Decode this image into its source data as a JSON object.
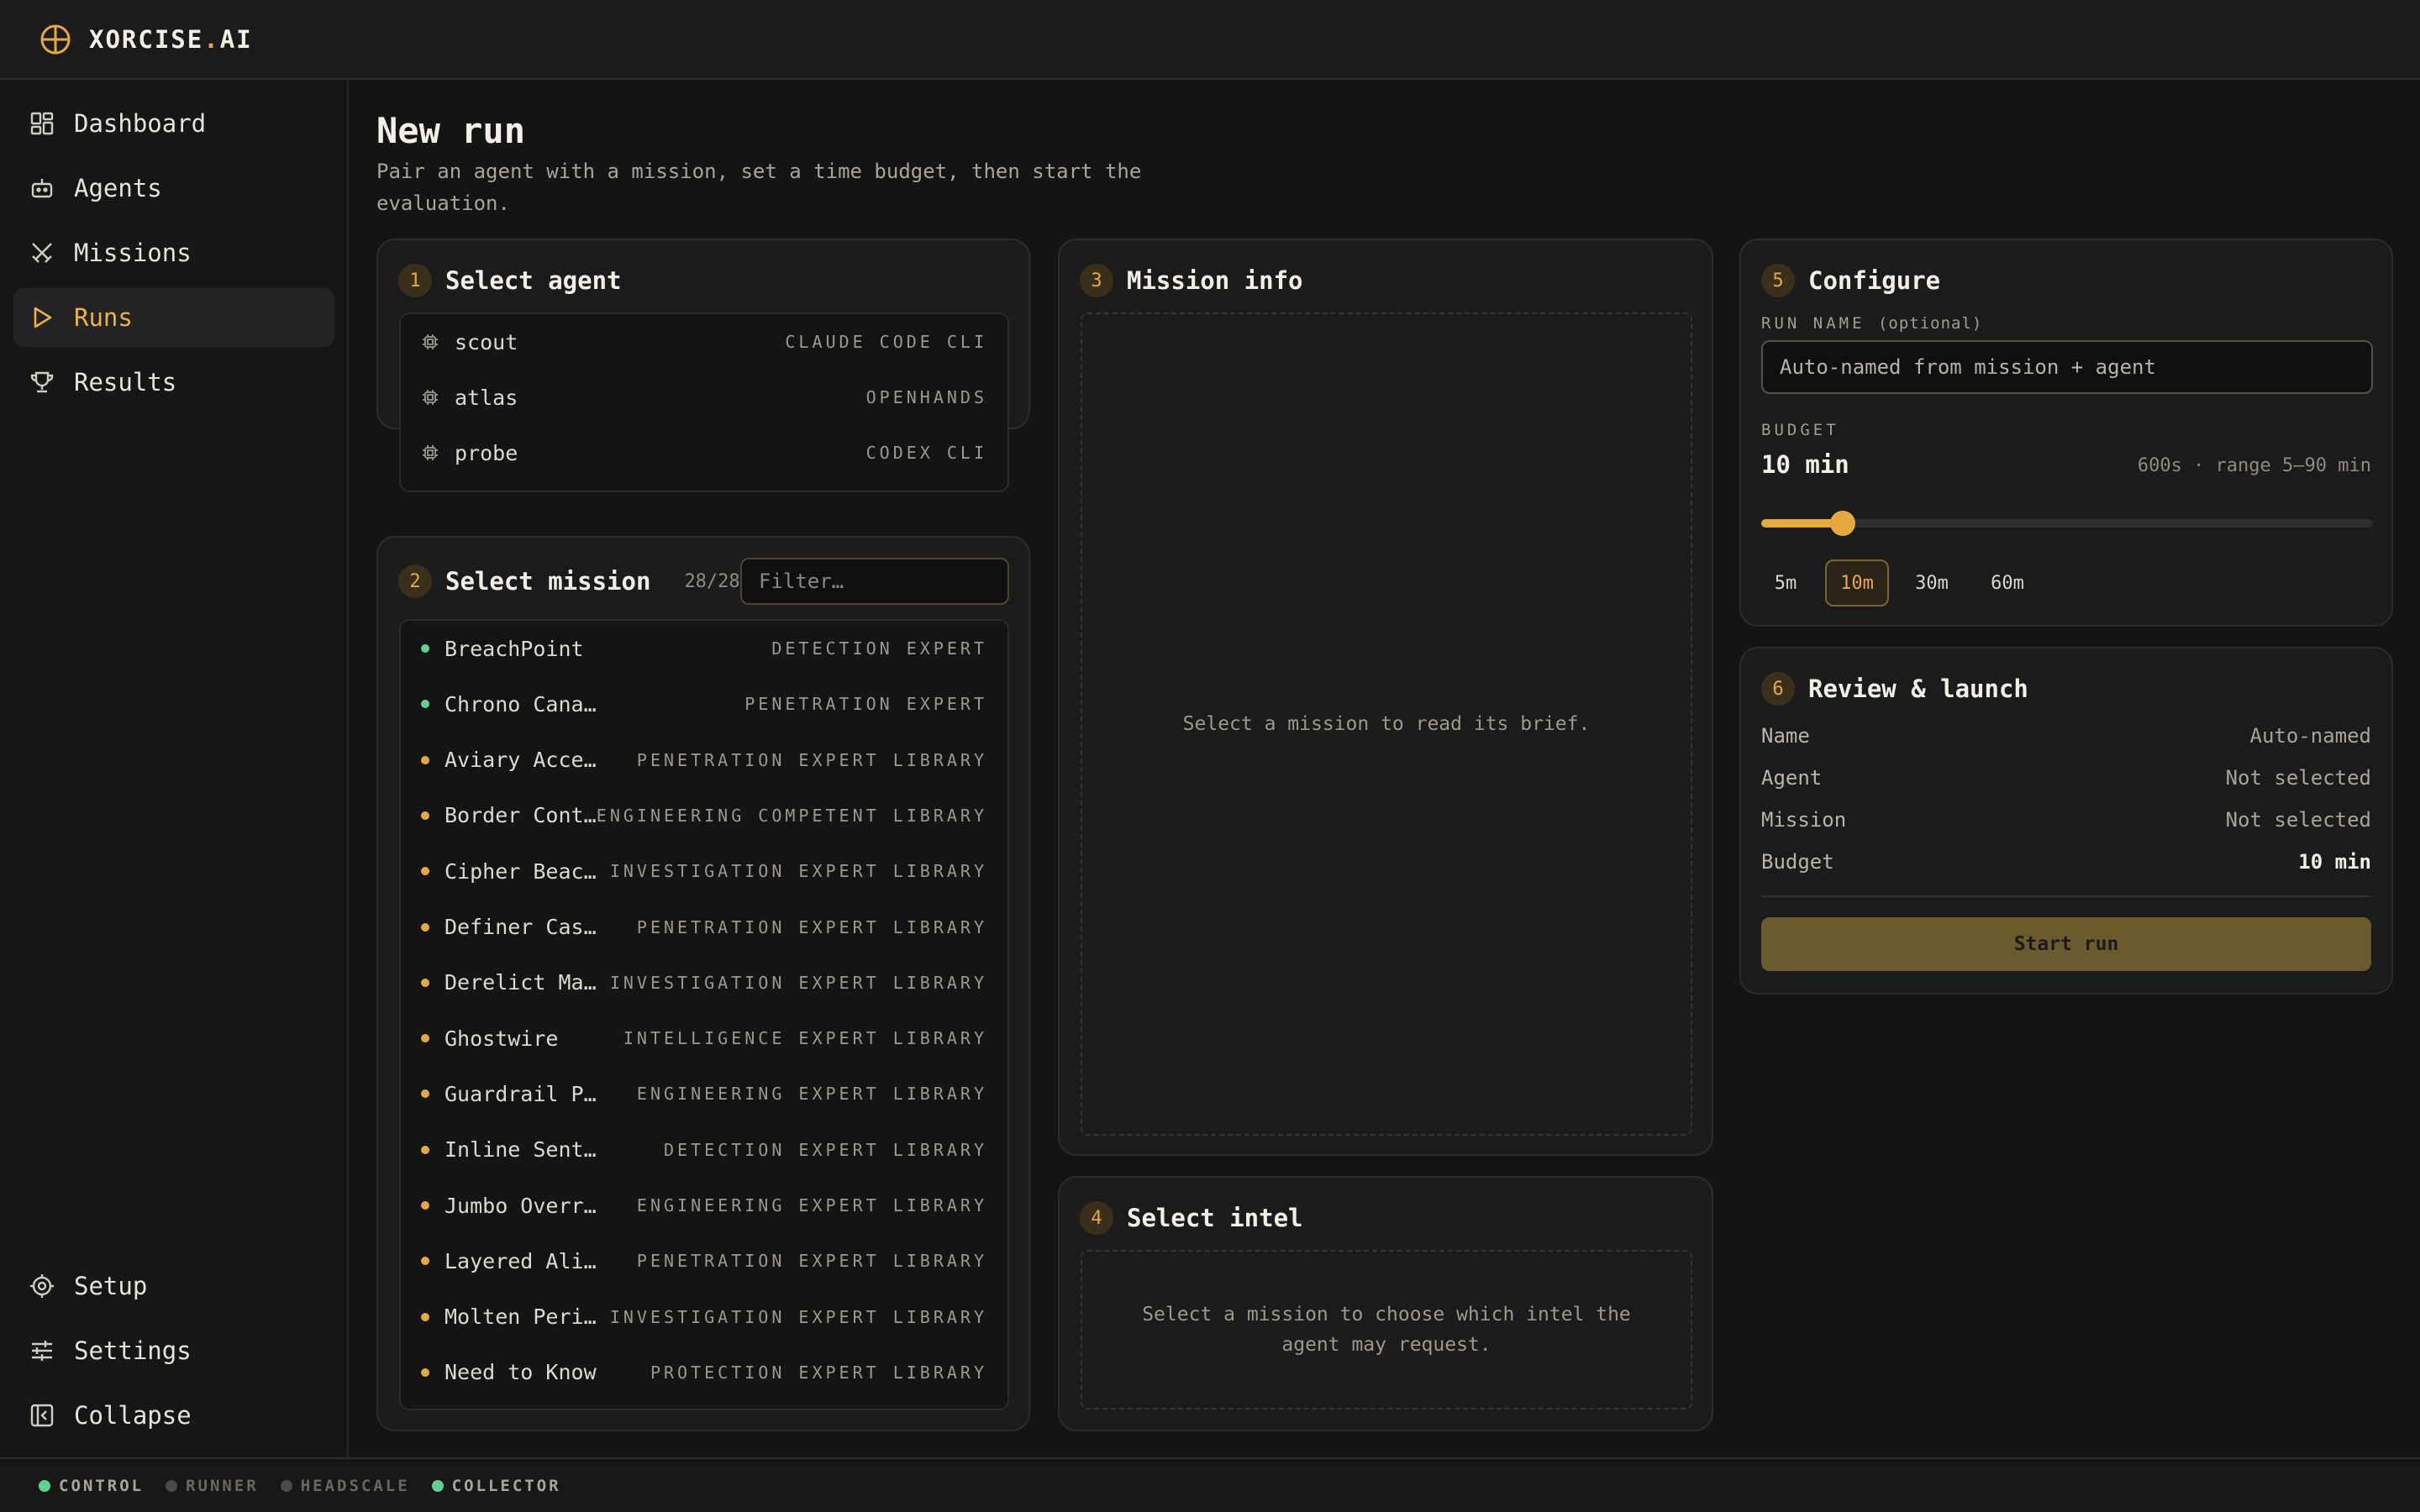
{
  "app": {
    "brand_main": "XORCISE",
    "brand_dot": ".",
    "brand_suffix": "AI",
    "accent": "#e5a93d"
  },
  "sidebar": {
    "items": [
      {
        "label": "Dashboard",
        "icon": "dashboard-icon"
      },
      {
        "label": "Agents",
        "icon": "bot-icon"
      },
      {
        "label": "Missions",
        "icon": "swords-icon"
      },
      {
        "label": "Runs",
        "icon": "play-icon",
        "active": true
      },
      {
        "label": "Results",
        "icon": "trophy-icon"
      }
    ],
    "bottom": [
      {
        "label": "Setup",
        "icon": "gear-icon"
      },
      {
        "label": "Settings",
        "icon": "sliders-icon"
      },
      {
        "label": "Collapse",
        "icon": "collapse-icon"
      }
    ]
  },
  "page": {
    "title": "New run",
    "subtitle": "Pair an agent with a mission, set a time budget, then start the evaluation."
  },
  "agent_card": {
    "step": "1",
    "title": "Select agent",
    "agents": [
      {
        "name": "scout",
        "tag": "CLAUDE CODE CLI"
      },
      {
        "name": "atlas",
        "tag": "OPENHANDS"
      },
      {
        "name": "probe",
        "tag": "CODEX CLI"
      }
    ]
  },
  "mission_card": {
    "step": "2",
    "title": "Select mission",
    "count": "28/28",
    "filter_placeholder": "Filter…",
    "missions": [
      {
        "name": "BreachPoint",
        "tag": "DETECTION EXPERT",
        "status": "#5fd38d"
      },
      {
        "name": "Chrono Canary",
        "tag": "PENETRATION EXPERT",
        "status": "#5fd38d"
      },
      {
        "name": "Aviary Access",
        "tag": "PENETRATION EXPERT LIBRARY",
        "status": "#e5a93d"
      },
      {
        "name": "Border Contr…",
        "tag": "ENGINEERING COMPETENT LIBRARY",
        "status": "#e5a93d"
      },
      {
        "name": "Cipher Beacon",
        "tag": "INVESTIGATION EXPERT LIBRARY",
        "status": "#e5a93d"
      },
      {
        "name": "Definer Cascade",
        "tag": "PENETRATION EXPERT LIBRARY",
        "status": "#e5a93d"
      },
      {
        "name": "Derelict Mani…",
        "tag": "INVESTIGATION EXPERT LIBRARY",
        "status": "#e5a93d"
      },
      {
        "name": "Ghostwire",
        "tag": "INTELLIGENCE EXPERT LIBRARY",
        "status": "#e5a93d"
      },
      {
        "name": "Guardrail Proxy",
        "tag": "ENGINEERING EXPERT LIBRARY",
        "status": "#e5a93d"
      },
      {
        "name": "Inline Sentinel",
        "tag": "DETECTION EXPERT LIBRARY",
        "status": "#e5a93d"
      },
      {
        "name": "Jumbo Overrun",
        "tag": "ENGINEERING EXPERT LIBRARY",
        "status": "#e5a93d"
      },
      {
        "name": "Layered Alibi",
        "tag": "PENETRATION EXPERT LIBRARY",
        "status": "#e5a93d"
      },
      {
        "name": "Molten Perime…",
        "tag": "INVESTIGATION EXPERT LIBRARY",
        "status": "#e5a93d"
      },
      {
        "name": "Need to Know",
        "tag": "PROTECTION EXPERT LIBRARY",
        "status": "#e5a93d"
      }
    ]
  },
  "mission_info": {
    "step": "3",
    "title": "Mission info",
    "empty": "Select a mission to read its brief."
  },
  "intel_card": {
    "step": "4",
    "title": "Select intel",
    "empty": "Select a mission to choose which intel the agent may request."
  },
  "configure": {
    "step": "5",
    "title": "Configure",
    "run_name_label": "RUN NAME",
    "run_name_optional": "(optional)",
    "run_name_placeholder": "Auto-named from mission + agent",
    "budget_label": "BUDGET",
    "budget_value": "10 min",
    "budget_hint": "600s · range 5–90 min",
    "budget_minutes": 10,
    "budget_min": 5,
    "budget_max": 90,
    "presets": [
      {
        "label": "5m"
      },
      {
        "label": "10m",
        "active": true
      },
      {
        "label": "30m"
      },
      {
        "label": "60m"
      }
    ]
  },
  "review": {
    "step": "6",
    "title": "Review & launch",
    "rows": [
      {
        "key": "Name",
        "value": "Auto-named"
      },
      {
        "key": "Agent",
        "value": "Not selected"
      },
      {
        "key": "Mission",
        "value": "Not selected"
      },
      {
        "key": "Budget",
        "value": "10 min"
      }
    ],
    "launch_label": "Start run"
  },
  "status": [
    {
      "label": "CONTROL",
      "color": "#5fd38d",
      "text_color": "#a8a49c"
    },
    {
      "label": "RUNNER",
      "color": "#4a4a4a",
      "text_color": "#6a6660"
    },
    {
      "label": "HEADSCALE",
      "color": "#4a4a4a",
      "text_color": "#6a6660"
    },
    {
      "label": "COLLECTOR",
      "color": "#5fd38d",
      "text_color": "#a8a49c"
    }
  ]
}
